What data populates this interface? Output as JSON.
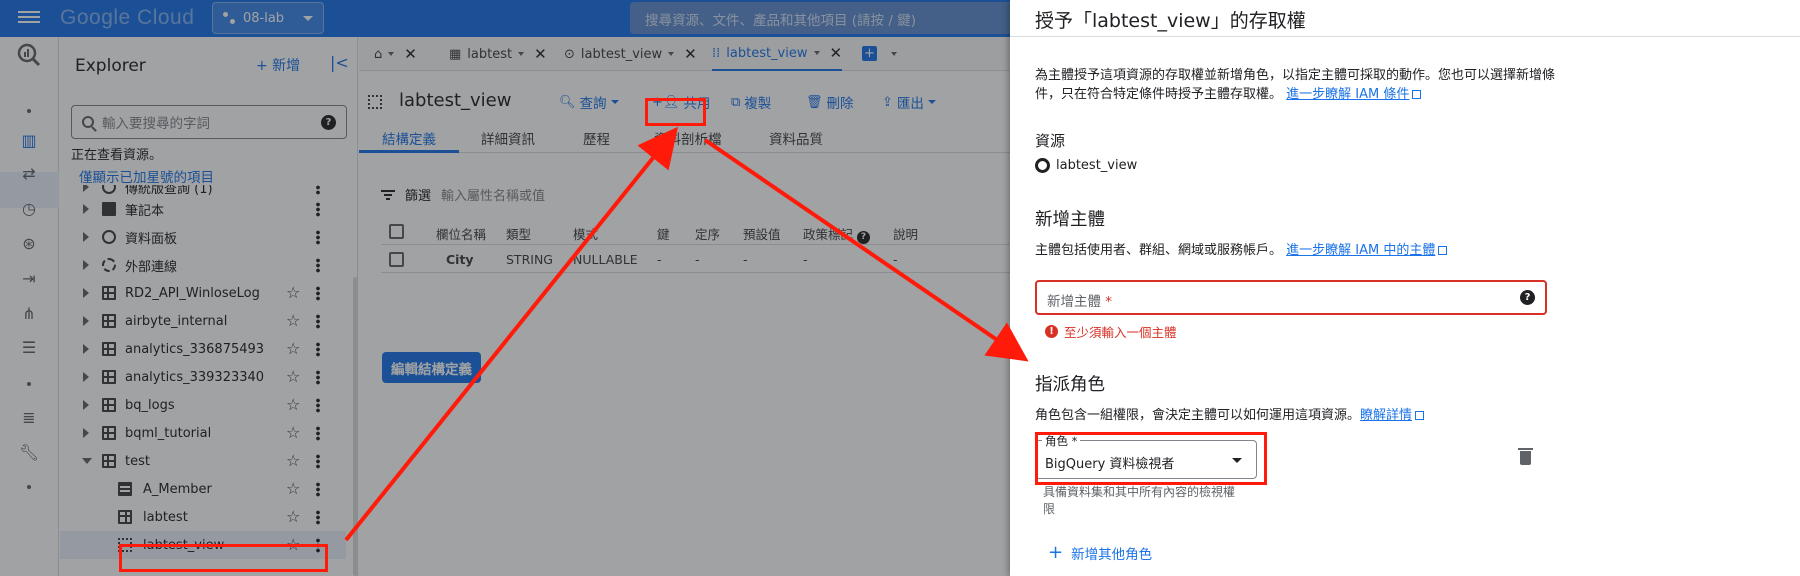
{
  "topbar": {
    "logo": "Google Cloud",
    "project": "08-lab",
    "search_placeholder": "搜尋資源、文件、產品和其他項目 (請按 / 鍵)"
  },
  "explorer": {
    "title": "Explorer",
    "add_label": "+ 新增",
    "search_placeholder": "輸入要搜尋的字詞",
    "status_text": "正在查看資源。",
    "starred_link": "僅顯示已加星號的項目",
    "items": [
      {
        "label": "傳統版查詢 (1)",
        "icon": "saved-query-icon",
        "starred": false
      },
      {
        "label": "筆記本",
        "icon": "notebook-icon",
        "starred": false
      },
      {
        "label": "資料面板",
        "icon": "canvas-icon",
        "starred": false
      },
      {
        "label": "外部連線",
        "icon": "connection-icon",
        "starred": false
      },
      {
        "label": "RD2_API_WinloseLog",
        "icon": "dataset-icon",
        "starred": true
      },
      {
        "label": "airbyte_internal",
        "icon": "dataset-icon",
        "starred": true
      },
      {
        "label": "analytics_336875493",
        "icon": "dataset-icon",
        "starred": true
      },
      {
        "label": "analytics_339323340",
        "icon": "dataset-icon",
        "starred": true
      },
      {
        "label": "bq_logs",
        "icon": "dataset-icon",
        "starred": true
      },
      {
        "label": "bqml_tutorial",
        "icon": "dataset-icon",
        "starred": true
      },
      {
        "label": "test",
        "icon": "dataset-icon",
        "starred": true
      },
      {
        "label": "A_Member",
        "icon": "table-icon",
        "starred": true
      },
      {
        "label": "labtest",
        "icon": "table-icon",
        "starred": true
      },
      {
        "label": "labtest_view",
        "icon": "view-icon",
        "starred": true
      }
    ]
  },
  "tabs": [
    {
      "label": "labtest"
    },
    {
      "label": "labtest_view"
    },
    {
      "label": "labtest_view"
    }
  ],
  "resource": {
    "title": "labtest_view",
    "actions": {
      "query": "查詢",
      "share": "共用",
      "copy": "複製",
      "delete": "刪除",
      "export": "匯出"
    },
    "subtabs": [
      "結構定義",
      "詳細資訊",
      "歷程",
      "資料剖析檔",
      "資料品質"
    ]
  },
  "schema": {
    "filter_label": "篩選",
    "filter_placeholder": "輸入屬性名稱或值",
    "columns": [
      "欄位名稱",
      "類型",
      "模式",
      "鍵",
      "定序",
      "預設值",
      "政策標記",
      "說明"
    ],
    "rows": [
      {
        "name": "City",
        "type": "STRING",
        "mode": "NULLABLE",
        "key": "-",
        "collation": "-",
        "default": "-",
        "policy": "-",
        "desc": "-"
      }
    ],
    "edit_button": "編輯結構定義"
  },
  "panel": {
    "title": "授予「labtest_view」的存取權",
    "desc": "為主體授予這項資源的存取權並新增角色，以指定主體可採取的動作。您也可以選擇新增條件，只在符合特定條件時授予主體存取權。",
    "desc_link": "進一步瞭解 IAM 條件",
    "resource_heading": "資源",
    "resource_name": "labtest_view",
    "add_principal_heading": "新增主體",
    "principal_desc": "主體包括使用者、群組、網域或服務帳戶。",
    "principal_link": "進一步瞭解 IAM 中的主體",
    "principal_label": "新增主體",
    "principal_required": "*",
    "principal_error": "至少須輸入一個主體",
    "assign_roles_heading": "指派角色",
    "roles_desc": "角色包含一組權限，會決定主體可以如何運用這項資源。",
    "roles_link": "瞭解詳情",
    "role_label": "角色 *",
    "role_value": "BigQuery 資料檢視者",
    "role_desc": "具備資料集和其中所有內容的檢視權限",
    "add_role_label": "新增其他角色"
  },
  "colors": {
    "accent": "#1a73e8",
    "error": "#d93025",
    "annotation": "#ff1a0a"
  }
}
